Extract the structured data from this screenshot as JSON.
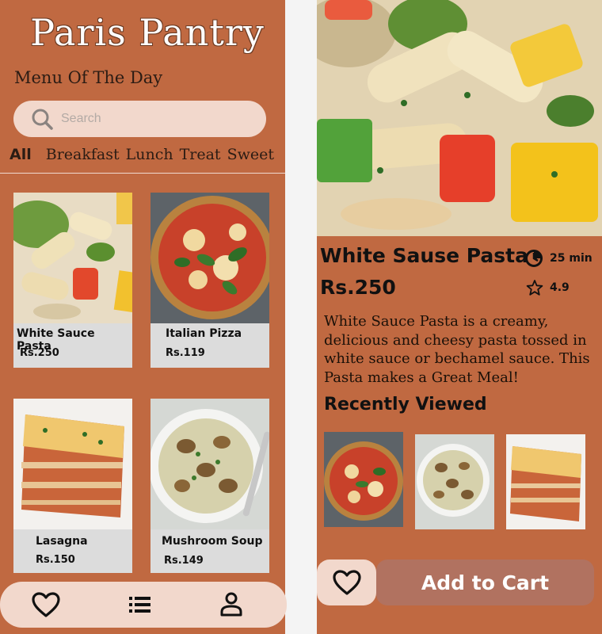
{
  "left": {
    "app_title": "Paris Pantry",
    "menu_heading": "Menu Of The Day",
    "search": {
      "placeholder": "Search"
    },
    "tabs": [
      {
        "label": "All",
        "active": true
      },
      {
        "label": "Breakfast",
        "active": false
      },
      {
        "label": "Lunch",
        "active": false
      },
      {
        "label": "Treat",
        "active": false
      },
      {
        "label": "Sweet",
        "active": false
      }
    ],
    "items": [
      {
        "name": "White Sauce Pasta",
        "price": "Rs.250"
      },
      {
        "name": "Italian Pizza",
        "price": "Rs.119"
      },
      {
        "name": "Lasagna",
        "price": "Rs.150"
      },
      {
        "name": "Mushroom Soup",
        "price": "Rs.149"
      }
    ],
    "nav": [
      "heart-icon",
      "list-icon",
      "user-icon"
    ]
  },
  "right": {
    "dish_title": "White Sause Pasta",
    "price": "Rs.250",
    "time": "25 min",
    "rating": "4.9",
    "description": "White Sauce Pasta is a creamy, delicious and cheesy pasta tossed in white sauce or bechamel sauce. This Pasta makes a Great Meal!",
    "recent_heading": "Recently Viewed",
    "cart_label": "Add to Cart"
  },
  "colors": {
    "background": "#c06941",
    "pill": "#f2d8cc",
    "card": "#dcdcdc",
    "cart_button": "#b17260"
  }
}
